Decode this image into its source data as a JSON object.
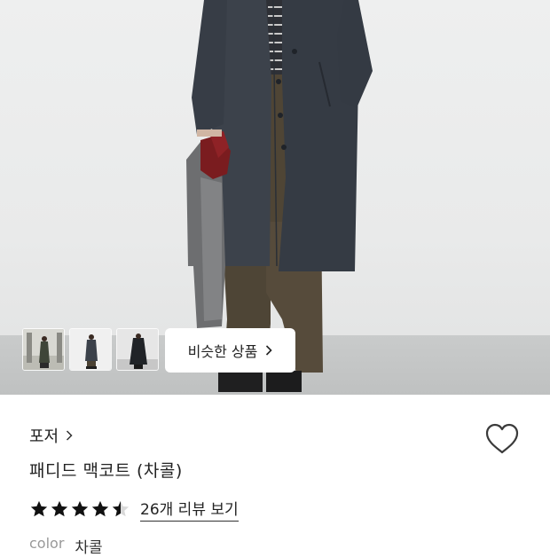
{
  "similar_button": {
    "label": "비슷한 상품"
  },
  "product": {
    "brand": "포저",
    "title": "패디드 맥코트 (차콜)",
    "rating": 4.5,
    "review_link": "26개 리뷰 보기",
    "color_label": "color",
    "color_value": "차콜"
  },
  "colors": {
    "accent_star": "#111111",
    "text": "#222222"
  },
  "icons": [
    "chevron-right-icon",
    "heart-icon",
    "star-icon"
  ]
}
